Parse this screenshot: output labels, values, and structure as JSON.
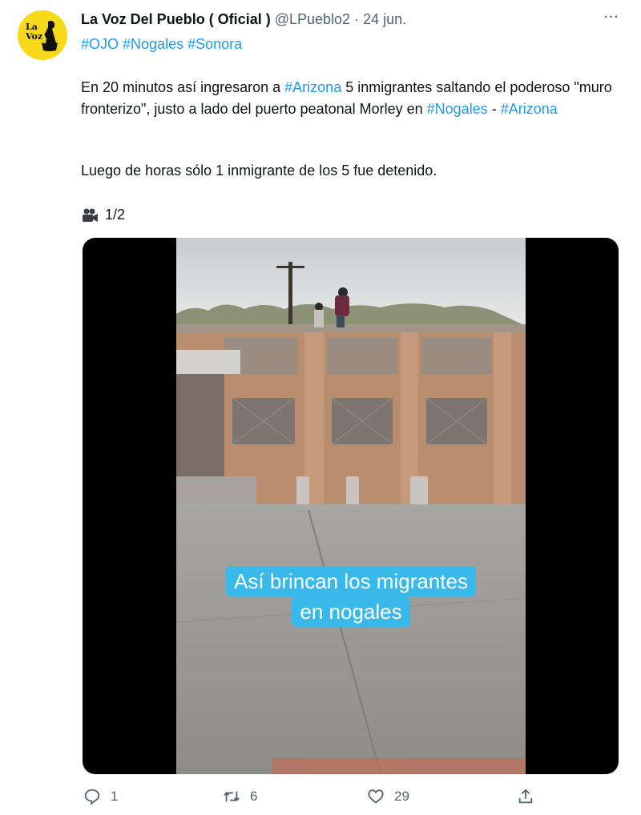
{
  "tweet": {
    "display_name": "La Voz Del Pueblo ( Oficial )",
    "handle": "@LPueblo2",
    "separator": "·",
    "date": "24 jun.",
    "more_label": "···",
    "hashtags": [
      "#OJO",
      "#Nogales",
      "#Sonora"
    ],
    "line1_before": "En 20 minutos así ingresaron a ",
    "line1_tag": "#Arizona",
    "line1_after": " 5 inmigrantes saltando el poderoso \"muro fronterizo\", justo a lado del puerto peatonal Morley en ",
    "line3_tag1": "#Nogales",
    "line3_dash": " - ",
    "line3_tag2": "#Arizona",
    "paragraph2": "Luego de horas sólo 1 inmigrante de los 5 fue detenido.",
    "media_counter": "1/2",
    "video_caption_line1": "Así brincan los migrantes",
    "video_caption_line2": "en nogales",
    "avatar_logo_text": "La Voz"
  },
  "actions": {
    "reply_count": "1",
    "retweet_count": "6",
    "like_count": "29"
  },
  "colors": {
    "link": "#1d9bf0",
    "secondary": "#536471",
    "caption_bg": "#39b8ea",
    "avatar_bg": "#f6d918"
  }
}
